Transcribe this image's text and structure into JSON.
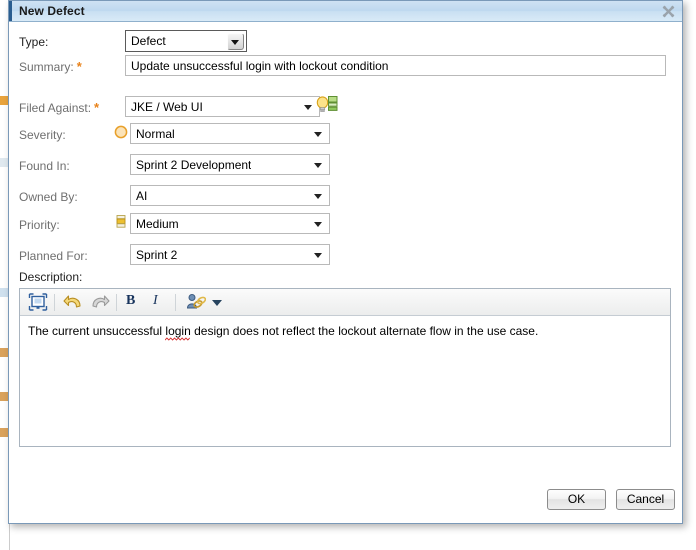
{
  "window": {
    "title": "New Defect",
    "close_icon": "close-x-icon"
  },
  "form": {
    "fields": [
      {
        "label": "Type:",
        "required": false,
        "value": "Defect",
        "control": "select3d",
        "icon": null
      },
      {
        "label": "Summary:",
        "required": true,
        "value": "Update unsuccessful login with lockout condition",
        "control": "text",
        "icon": null
      },
      {
        "label": "Filed Against:",
        "required": true,
        "value": "JKE / Web UI",
        "control": "select",
        "icon": null
      },
      {
        "label": "Severity:",
        "required": false,
        "value": "Normal",
        "control": "select",
        "icon": "severity-normal-icon"
      },
      {
        "label": "Found In:",
        "required": false,
        "value": "Sprint 2 Development",
        "control": "select",
        "icon": null
      },
      {
        "label": "Owned By:",
        "required": false,
        "value": "AI",
        "control": "select",
        "icon": null
      },
      {
        "label": "Priority:",
        "required": false,
        "value": "Medium",
        "control": "select",
        "icon": "priority-medium-icon"
      },
      {
        "label": "Planned For:",
        "required": false,
        "value": "Sprint 2",
        "control": "select",
        "icon": null
      }
    ],
    "filed_against_helper_icon": "lightbulb-suggestion-icon"
  },
  "description": {
    "label": "Description:",
    "toolbar": [
      {
        "name": "maximize-editor-icon",
        "kind": "icon"
      },
      {
        "name": "undo-icon",
        "kind": "icon"
      },
      {
        "name": "redo-icon",
        "kind": "icon"
      },
      {
        "name": "bold-button",
        "kind": "text",
        "label": "B"
      },
      {
        "name": "italic-button",
        "kind": "text",
        "label": "I"
      },
      {
        "name": "insert-link-icon",
        "kind": "icon"
      },
      {
        "name": "chevron-down-icon",
        "kind": "caret"
      }
    ],
    "body_before": "The current unsuccessful ",
    "body_misspelled": "login",
    "body_after": " design does not reflect the lockout alternate flow in the use case."
  },
  "footer": {
    "ok_label": "OK",
    "cancel_label": "Cancel"
  },
  "colors": {
    "titlebar": "#c5dcf0",
    "required_asterisk": "#e8821a",
    "label_gray": "#6f6f6f",
    "severity_orange": "#f0a830",
    "priority_yellow": "#edbe36",
    "spellcheck_red": "#d42a2a"
  }
}
